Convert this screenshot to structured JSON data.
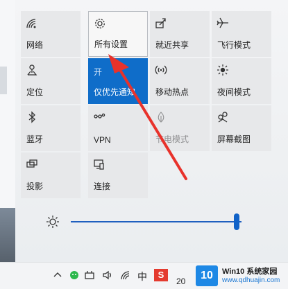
{
  "tiles": [
    {
      "label": "网络",
      "icon": "network-icon",
      "state": "normal"
    },
    {
      "label": "所有设置",
      "icon": "gear-icon",
      "state": "hover"
    },
    {
      "label": "就近共享",
      "icon": "share-icon",
      "state": "normal"
    },
    {
      "label": "飞行模式",
      "icon": "airplane-icon",
      "state": "normal"
    },
    {
      "label": "定位",
      "icon": "location-icon",
      "state": "normal"
    },
    {
      "label": "仅优先通知",
      "icon": "moon-icon",
      "state": "active",
      "status": "开"
    },
    {
      "label": "移动热点",
      "icon": "hotspot-icon",
      "state": "normal"
    },
    {
      "label": "夜间模式",
      "icon": "brightness-icon",
      "state": "normal"
    },
    {
      "label": "蓝牙",
      "icon": "bluetooth-icon",
      "state": "normal"
    },
    {
      "label": "VPN",
      "icon": "vpn-icon",
      "state": "normal"
    },
    {
      "label": "节电模式",
      "icon": "battery-saver-icon",
      "state": "disabled"
    },
    {
      "label": "屏幕截图",
      "icon": "snip-icon",
      "state": "normal"
    },
    {
      "label": "投影",
      "icon": "project-icon",
      "state": "normal"
    },
    {
      "label": "连接",
      "icon": "connect-icon",
      "state": "normal"
    }
  ],
  "brightness": {
    "level": 0.97
  },
  "taskbar": {
    "time": "20"
  },
  "watermark": {
    "line1": "Win10 系统家园",
    "line2": "www.qdhuajin.com",
    "logo": "10"
  },
  "colors": {
    "accent": "#0f6dc9",
    "arrow": "#e8322b"
  }
}
